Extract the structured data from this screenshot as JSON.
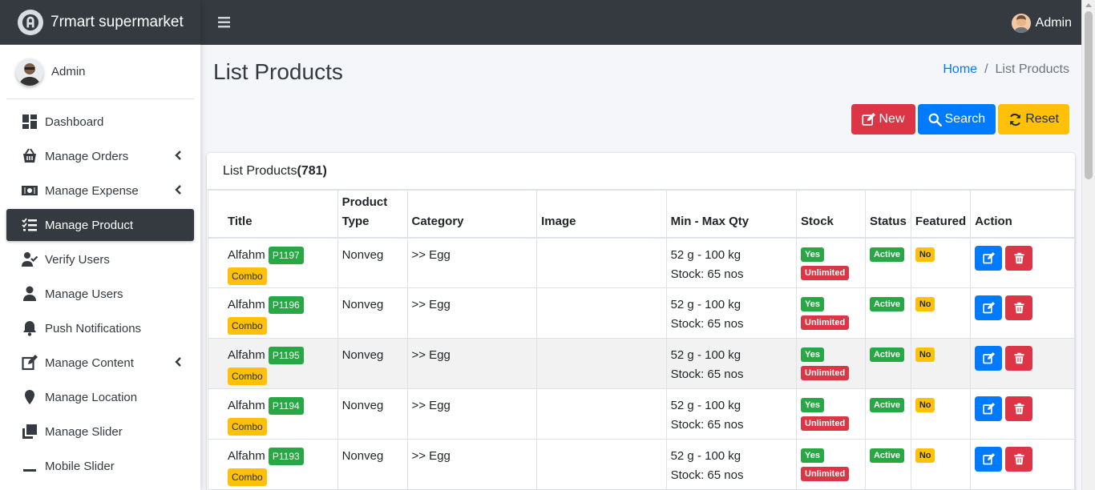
{
  "brand": {
    "name": "7rmart supermarket"
  },
  "sidebar": {
    "user": "Admin",
    "items": [
      {
        "label": "Dashboard",
        "icon": "dashboard-icon",
        "caret": false,
        "active": false
      },
      {
        "label": "Manage Orders",
        "icon": "basket-icon",
        "caret": true,
        "active": false
      },
      {
        "label": "Manage Expense",
        "icon": "money-icon",
        "caret": true,
        "active": false
      },
      {
        "label": "Manage Product",
        "icon": "list-check-icon",
        "caret": false,
        "active": true
      },
      {
        "label": "Verify Users",
        "icon": "user-check-icon",
        "caret": false,
        "active": false
      },
      {
        "label": "Manage Users",
        "icon": "user-icon",
        "caret": false,
        "active": false
      },
      {
        "label": "Push Notifications",
        "icon": "bell-icon",
        "caret": false,
        "active": false
      },
      {
        "label": "Manage Content",
        "icon": "edit-icon",
        "caret": true,
        "active": false
      },
      {
        "label": "Manage Location",
        "icon": "map-marker-icon",
        "caret": false,
        "active": false
      },
      {
        "label": "Manage Slider",
        "icon": "clone-icon",
        "caret": false,
        "active": false
      },
      {
        "label": "Mobile Slider",
        "icon": "minus-icon",
        "caret": false,
        "active": false
      }
    ]
  },
  "topbar": {
    "user": "Admin"
  },
  "page": {
    "title": "List Products",
    "breadcrumb": {
      "home": "Home",
      "current": "List Products"
    }
  },
  "toolbar": {
    "new_label": "New",
    "search_label": "Search",
    "reset_label": "Reset"
  },
  "card": {
    "title": "List Products",
    "count": "(781)"
  },
  "table": {
    "headers": {
      "title": "Title",
      "type_line1": "Product",
      "type_line2": "Type",
      "category": "Category",
      "image": "Image",
      "qty": "Min - Max Qty",
      "stock": "Stock",
      "status": "Status",
      "featured": "Featured",
      "action": "Action"
    },
    "rows": [
      {
        "title": "Alfahm",
        "code": "P1197",
        "tag": "Combo",
        "type": "Nonveg",
        "category": ">> Egg",
        "qty": "52 g - 100 kg",
        "stock_qty": "Stock: 65 nos",
        "stock": "Yes",
        "stock_limit": "Unlimited",
        "status": "Active",
        "featured": "No"
      },
      {
        "title": "Alfahm",
        "code": "P1196",
        "tag": "Combo",
        "type": "Nonveg",
        "category": ">> Egg",
        "qty": "52 g - 100 kg",
        "stock_qty": "Stock: 65 nos",
        "stock": "Yes",
        "stock_limit": "Unlimited",
        "status": "Active",
        "featured": "No"
      },
      {
        "title": "Alfahm",
        "code": "P1195",
        "tag": "Combo",
        "type": "Nonveg",
        "category": ">> Egg",
        "qty": "52 g - 100 kg",
        "stock_qty": "Stock: 65 nos",
        "stock": "Yes",
        "stock_limit": "Unlimited",
        "status": "Active",
        "featured": "No"
      },
      {
        "title": "Alfahm",
        "code": "P1194",
        "tag": "Combo",
        "type": "Nonveg",
        "category": ">> Egg",
        "qty": "52 g - 100 kg",
        "stock_qty": "Stock: 65 nos",
        "stock": "Yes",
        "stock_limit": "Unlimited",
        "status": "Active",
        "featured": "No"
      },
      {
        "title": "Alfahm",
        "code": "P1193",
        "tag": "Combo",
        "type": "Nonveg",
        "category": ">> Egg",
        "qty": "52 g - 100 kg",
        "stock_qty": "Stock: 65 nos",
        "stock": "Yes",
        "stock_limit": "Unlimited",
        "status": "Active",
        "featured": "No"
      }
    ]
  },
  "colors": {
    "dark": "#343a40",
    "primary": "#007bff",
    "danger": "#dc3545",
    "warning": "#ffc107",
    "success": "#28a745"
  }
}
